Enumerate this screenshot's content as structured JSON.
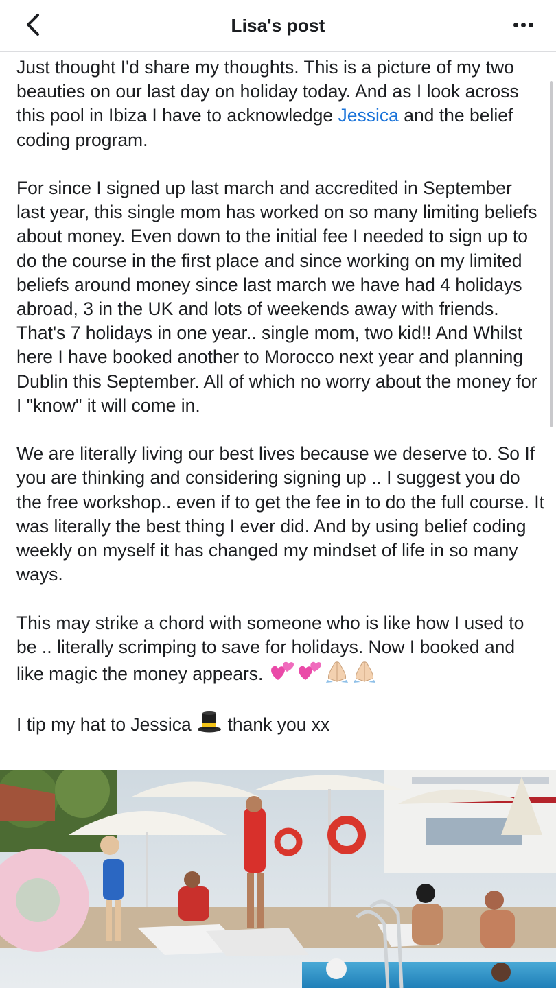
{
  "header": {
    "title": "Lisa's post",
    "back_icon": "chevron-left-icon",
    "more_icon": "more-horizontal-icon"
  },
  "post": {
    "p1_before": "Just thought I'd share my thoughts. This is a picture of my two beauties on our last day on holiday today. And as I look across this pool in Ibiza I have to acknowledge ",
    "p1_mention": "Jessica",
    "p1_after": " and the belief coding program.",
    "p2": "For since I signed up last march and accredited in September last year, this single mom has worked on so many limiting beliefs about money. Even down to the initial fee I needed to sign up to do the course in the first place and since working on my limited beliefs around money since last march we have had 4 holidays abroad, 3 in the UK and lots of weekends away with friends. That's 7 holidays in one year.. single mom, two kid!! And Whilst here I have booked another to Morocco next year and planning Dublin this September. All of which no worry about the money for I \"know\" it will come in.",
    "p3": "We are literally living our best lives because we deserve to. So If you are thinking and considering signing up .. I suggest you do the free workshop.. even if to get the fee in to do the full course. It was literally the best thing I ever did. And by using belief coding weekly on myself it has changed my mindset of life in so many ways.",
    "p4_text": "This may strike a chord with someone who is like how I used to be ..  literally scrimping to save for holidays. Now I booked and like magic the money appears. ",
    "p5_before": "I tip my hat to Jessica ",
    "p5_after": " thank you xx"
  },
  "photo": {
    "icon": "poolside-photo"
  },
  "colors": {
    "mention": "#1a73d9",
    "text": "#1c1e21",
    "divider": "#dcdde0"
  }
}
